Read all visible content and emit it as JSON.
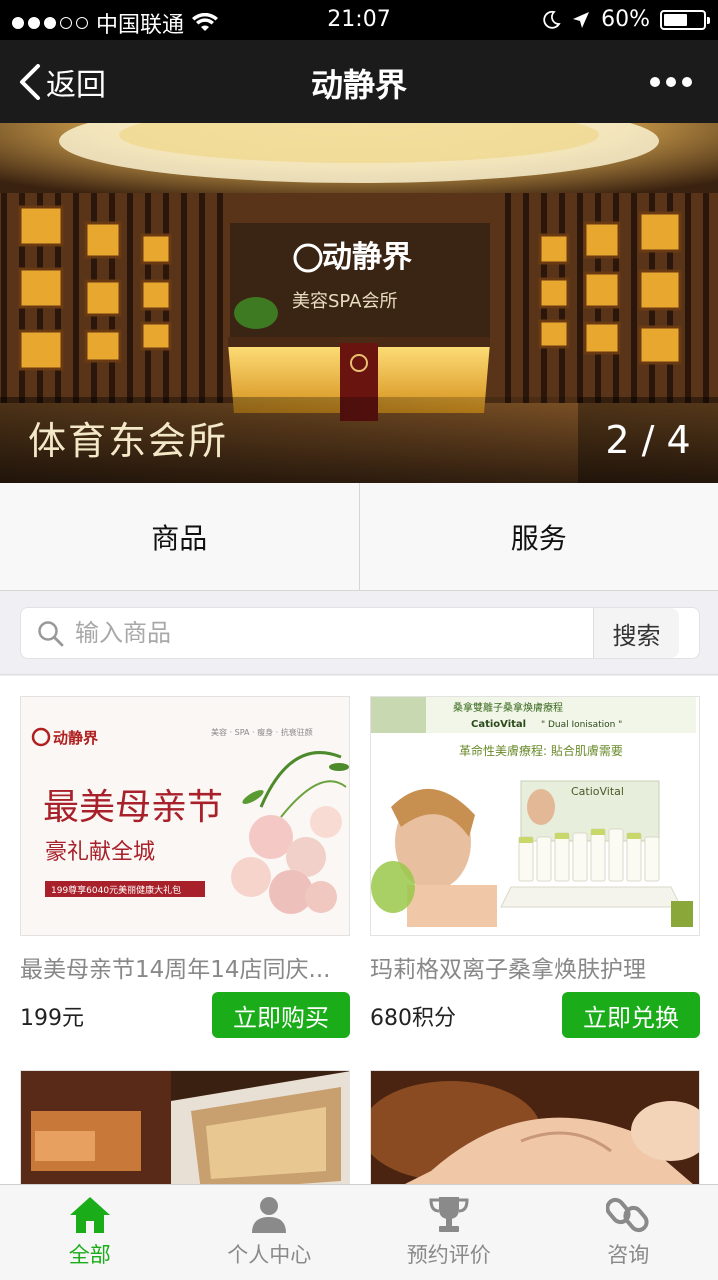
{
  "status_bar": {
    "carrier": "中国联通",
    "time": "21:07",
    "battery": "60%",
    "battery_level": 0.6,
    "signal_bars": 3
  },
  "nav": {
    "back_label": "返回",
    "title": "动静界"
  },
  "banner": {
    "caption": "体育东会所",
    "counter": "2 / 4",
    "sign_text": "动静界",
    "sign_sub": "美容SPA会所"
  },
  "tabs": [
    {
      "label": "商品"
    },
    {
      "label": "服务"
    }
  ],
  "search": {
    "placeholder": "输入商品",
    "button_label": "搜索"
  },
  "products": [
    {
      "name": "最美母亲节14周年14店同庆...",
      "price": "199元",
      "button": "立即购买",
      "poster": {
        "brand": "动静界",
        "headline": "最美母亲节",
        "tagline": "豪礼献全城",
        "strip": "199尊享6040元美丽健康大礼包",
        "tags": "美容 · SPA · 瘦身 · 抗衰驻颜"
      }
    },
    {
      "name": "玛莉格双离子桑拿焕肤护理",
      "price": "680积分",
      "button": "立即兑换",
      "poster": {
        "heading": "桑拿雙離子桑拿煥膚療程",
        "brand_line": "CatioVital",
        "brand_sub": "\" Dual Ionisation \"",
        "subtitle": "革命性美膚療程: 貼合肌膚需要",
        "box_brand": "CatioVital"
      }
    },
    {
      "name": "",
      "price": "",
      "button": ""
    },
    {
      "name": "",
      "price": "",
      "button": ""
    }
  ],
  "tabbar": [
    {
      "label": "全部",
      "icon": "home-icon",
      "active": true
    },
    {
      "label": "个人中心",
      "icon": "user-icon",
      "active": false
    },
    {
      "label": "预约评价",
      "icon": "trophy-icon",
      "active": false
    },
    {
      "label": "咨询",
      "icon": "link-icon",
      "active": false
    }
  ],
  "colors": {
    "accent": "#1aad19",
    "nav_bg": "#1b1b1b",
    "status_bg": "#000000"
  }
}
